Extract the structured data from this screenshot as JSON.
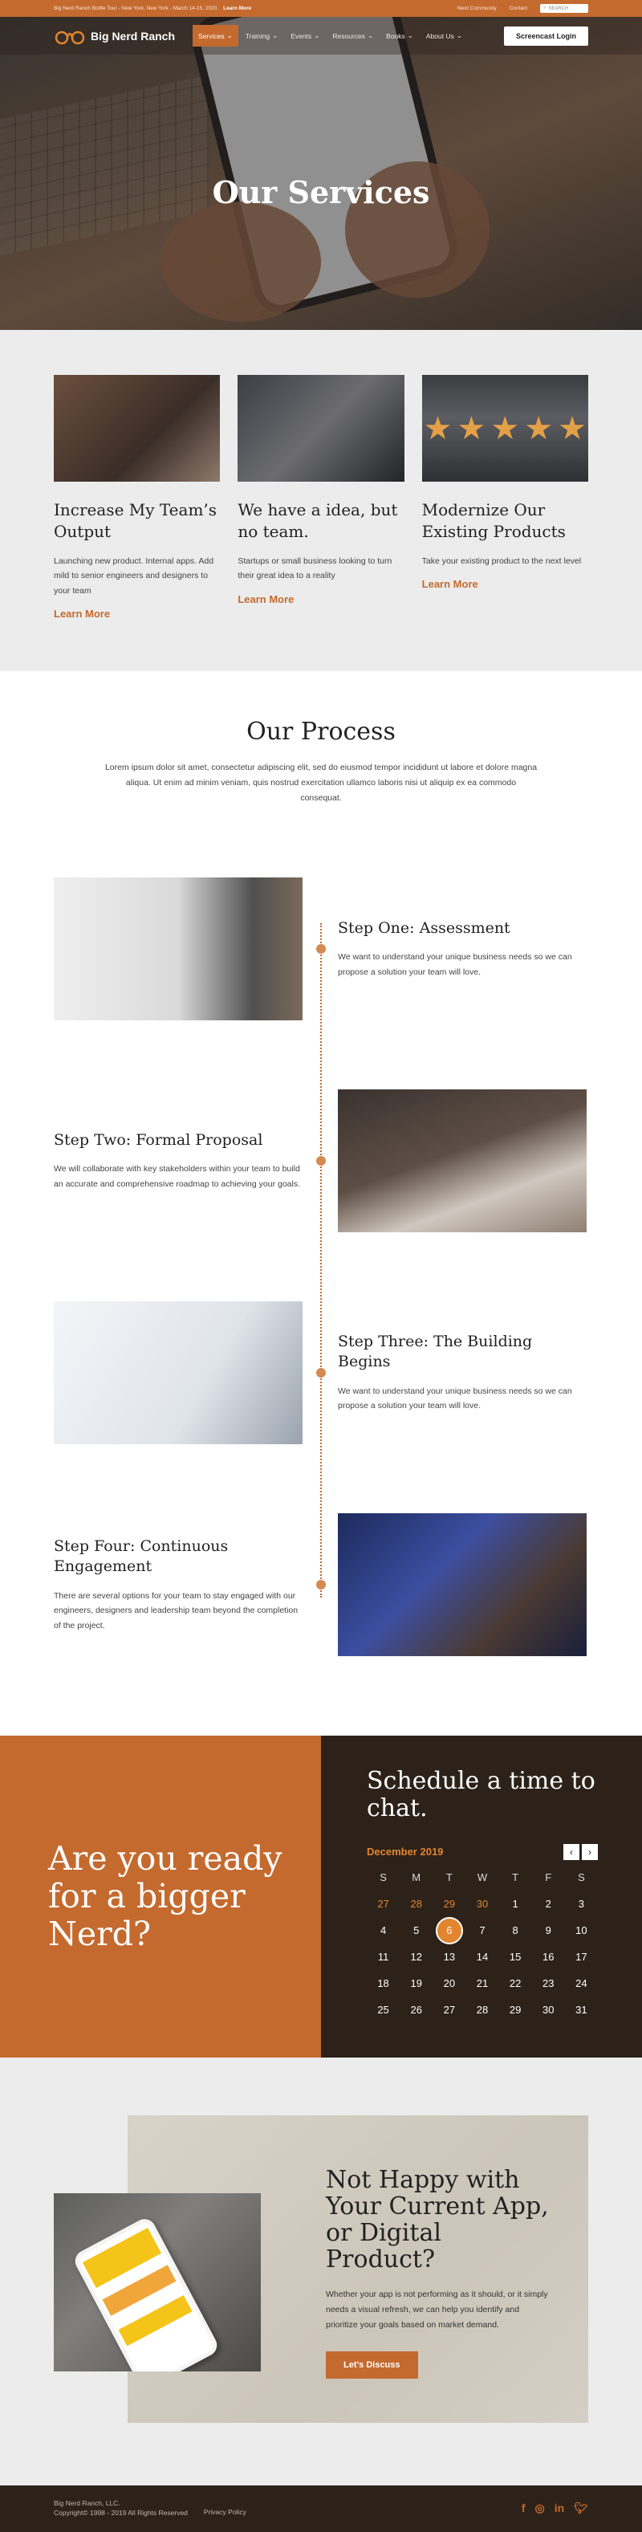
{
  "announcement": {
    "text": "Big Nerd Ranch Bottle Tour - New York, New York - March 14-15, 2020.",
    "link": "Learn More",
    "community": "Nerd Community",
    "contact": "Contact",
    "search_placeholder": "SEARCH"
  },
  "header": {
    "logo": "Big Nerd Ranch",
    "nav": [
      "Services",
      "Training",
      "Events",
      "Resources",
      "Books",
      "About Us"
    ],
    "login": "Screencast Login"
  },
  "hero": {
    "title": "Our Services"
  },
  "services": [
    {
      "title": "Increase My Team’s Output",
      "text": "Launching new product. Internal apps. Add mild to senior engineers and designers to your team",
      "link": "Learn More"
    },
    {
      "title": "We have a idea, but no team.",
      "text": "Startups or small business looking to turn their great idea to a reality",
      "link": "Learn More"
    },
    {
      "title": "Modernize Our Existing Products",
      "text": "Take your existing product to the next level",
      "link": "Learn More"
    }
  ],
  "process": {
    "title": "Our Process",
    "intro": "Lorem ipsum dolor sit amet, consectetur adipiscing elit, sed do eiusmod tempor incididunt ut labore et dolore magna aliqua. Ut enim ad minim veniam, quis nostrud exercitation ullamco laboris nisi ut aliquip ex ea commodo consequat.",
    "steps": [
      {
        "title": "Step One: Assessment",
        "text": "We want to understand your unique business needs so we can propose a solution your team will love."
      },
      {
        "title": "Step Two: Formal Proposal",
        "text": "We will collaborate with key stakeholders within your team to build an accurate and comprehensive roadmap to achieving your goals."
      },
      {
        "title": "Step Three: The Building Begins",
        "text": "We want to understand your unique business needs so we can propose a solution your team will love."
      },
      {
        "title": "Step Four: Continuous Engagement",
        "text": "There are several options for your team to stay engaged with our engineers, designers and leadership team beyond the completion of the project."
      }
    ]
  },
  "cta": {
    "headline": "Are you ready for a bigger Nerd?",
    "schedule_title": "Schedule a time to chat.",
    "month": "December 2019",
    "weekdays": [
      "S",
      "M",
      "T",
      "W",
      "T",
      "F",
      "S"
    ],
    "days": [
      [
        "27",
        "28",
        "29",
        "30",
        "1",
        "2",
        "3"
      ],
      [
        "4",
        "5",
        "6",
        "7",
        "8",
        "9",
        "10"
      ],
      [
        "11",
        "12",
        "13",
        "14",
        "15",
        "16",
        "17"
      ],
      [
        "18",
        "19",
        "20",
        "21",
        "22",
        "23",
        "24"
      ],
      [
        "25",
        "26",
        "27",
        "28",
        "29",
        "30",
        "31"
      ]
    ],
    "selected_day": "6"
  },
  "unhappy": {
    "title": "Not Happy with Your Current App, or Digital Product?",
    "text": "Whether your app is not performing as it should, or it simply needs a visual refresh, we can help you identify and prioritize your goals based on market demand.",
    "button": "Let’s Discuss"
  },
  "footer": {
    "company": "Big Nerd Ranch, LLC.",
    "copyright": "Copyright© 1998 - 2019 All Rights Reserved",
    "privacy": "Privacy Policy",
    "social": [
      "facebook-icon",
      "instagram-icon",
      "linkedin-icon",
      "twitter-icon"
    ]
  }
}
